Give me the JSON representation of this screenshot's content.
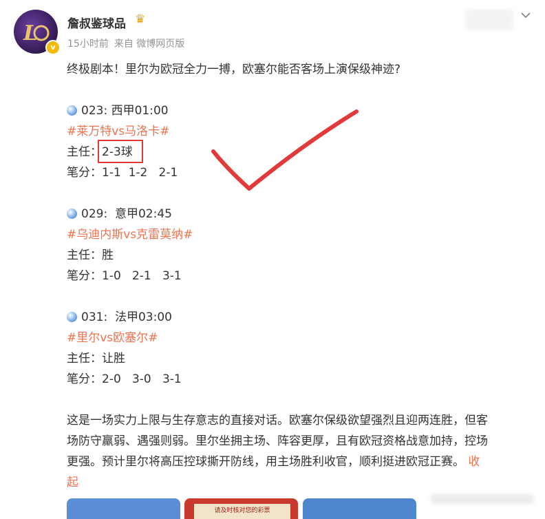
{
  "post": {
    "username": "詹叔鉴球品",
    "meta_time": "15小时前",
    "meta_source": "来自 微博网页版",
    "headline": "终极剧本！里尔为欧冠全力一搏，欧塞尔能否客场上演保级神迹?",
    "matches": [
      {
        "code": "023: 西甲01:00",
        "topic": "#莱万特vs马洛卡#",
        "pick_label": "主任：",
        "pick_value": "2-3球",
        "score_label": "笔分：",
        "score_value": "1-1  1-2   2-1"
      },
      {
        "code": "029:  意甲02:45",
        "topic": "#乌迪内斯vs克雷莫纳#",
        "pick_label": "主任：",
        "pick_value": "胜",
        "score_label": "笔分：",
        "score_value": "1-0   2-1   3-1"
      },
      {
        "code": "031:  法甲03:00",
        "topic": "#里尔vs欧塞尔#",
        "pick_label": "主任：",
        "pick_value": "让胜",
        "score_label": "笔分：",
        "score_value": "2-0   3-0   3-1"
      }
    ],
    "summary_line1": "这是一场实力上限与生存意志的直接对话。欧塞尔保级欲望强烈且迎两连胜，但客",
    "summary_line2": "场防守羸弱、遇强则弱。里尔坐拥主场、阵容更厚，且有欧冠资格战意加持，控场",
    "summary_line3": "更强。预计里尔将高压控球撕开防线，用主场胜利收官，顺利挺进欧冠正赛。",
    "fold_label_a": "收",
    "fold_label_b": "起",
    "thumb2_text": "请及时核对您的彩票"
  },
  "colors": {
    "topic": "#eb7350",
    "annotation_red": "#e23a3a",
    "meta_gray": "#939393"
  },
  "icons": [
    "avatar",
    "vip-crown-icon",
    "verified-badge-icon",
    "chevron-down-icon",
    "soccer-ball-icon",
    "check-mark-annotation"
  ]
}
